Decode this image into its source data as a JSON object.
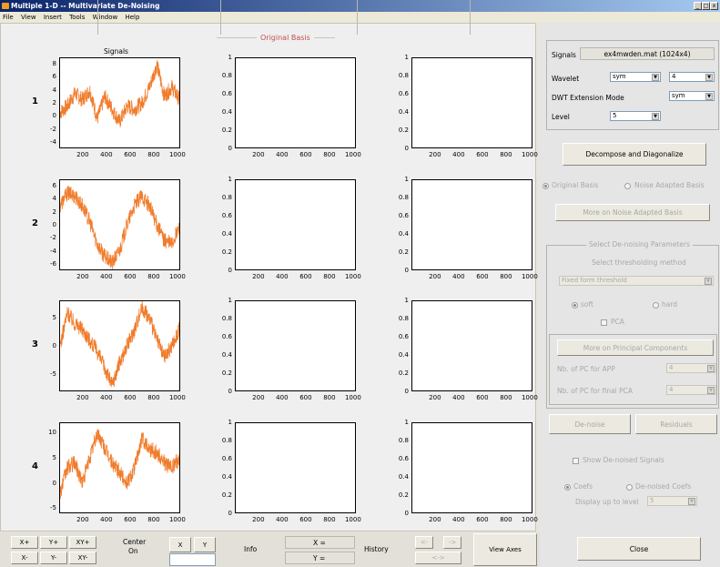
{
  "window": {
    "title": "Multiple 1-D -- Multivariate De-Noising",
    "controls": [
      "_",
      "□",
      "x"
    ]
  },
  "menu": [
    "File",
    "View",
    "Insert",
    "Tools",
    "Window",
    "Help"
  ],
  "plots": {
    "section_title": "Original Basis",
    "column_title": "Signals",
    "row_labels": [
      "1",
      "2",
      "3",
      "4"
    ],
    "x_ticks": [
      "200",
      "400",
      "600",
      "800",
      "1000"
    ],
    "empty_y_ticks": [
      "1",
      "0.8",
      "0.6",
      "0.4",
      "0.2",
      "0"
    ],
    "signal_y_ticks": [
      [
        "8",
        "6",
        "4",
        "2",
        "0",
        "-2",
        "-4"
      ],
      [
        "6",
        "4",
        "2",
        "0",
        "-2",
        "-4",
        "-6"
      ],
      [
        "5",
        "0",
        "-5"
      ],
      [
        "10",
        "5",
        "0",
        "-5"
      ]
    ]
  },
  "chart_data": [
    {
      "type": "line",
      "title": "Signals",
      "ylabel": "1",
      "xlim": [
        1,
        1024
      ],
      "ylim": [
        -5,
        9
      ],
      "series": [
        {
          "color": "#f07c2c",
          "x": [
            1,
            64,
            128,
            192,
            256,
            320,
            384,
            448,
            512,
            576,
            640,
            704,
            768,
            832,
            896,
            960,
            1024
          ],
          "values": [
            0.5,
            1.5,
            3.5,
            2.5,
            4,
            -0.5,
            3,
            1,
            -1,
            1.5,
            1,
            2,
            4.5,
            8,
            3,
            4.5,
            2.5
          ]
        }
      ]
    },
    {
      "type": "line",
      "ylabel": "2",
      "xlim": [
        1,
        1024
      ],
      "ylim": [
        -7,
        7
      ],
      "series": [
        {
          "color": "#f07c2c",
          "x": [
            1,
            64,
            128,
            192,
            256,
            320,
            384,
            448,
            512,
            576,
            640,
            704,
            768,
            832,
            896,
            960,
            1024
          ],
          "values": [
            3,
            5,
            4.5,
            3,
            0.5,
            -3,
            -5,
            -6,
            -4,
            0,
            3,
            4.5,
            3,
            0,
            -2.5,
            -3,
            -0.5
          ]
        }
      ]
    },
    {
      "type": "line",
      "ylabel": "3",
      "xlim": [
        1,
        1024
      ],
      "ylim": [
        -8,
        8
      ],
      "series": [
        {
          "color": "#f07c2c",
          "x": [
            1,
            64,
            128,
            192,
            256,
            320,
            384,
            448,
            512,
            576,
            640,
            704,
            768,
            832,
            896,
            960,
            1024
          ],
          "values": [
            0,
            6,
            4,
            3,
            1,
            -1,
            -4,
            -7,
            -3,
            0,
            3,
            7,
            5,
            1,
            -2,
            0,
            3
          ]
        }
      ]
    },
    {
      "type": "line",
      "ylabel": "4",
      "xlim": [
        1,
        1024
      ],
      "ylim": [
        -6,
        12
      ],
      "series": [
        {
          "color": "#f07c2c",
          "x": [
            1,
            64,
            128,
            192,
            256,
            320,
            384,
            448,
            512,
            576,
            640,
            704,
            768,
            832,
            896,
            960,
            1024
          ],
          "values": [
            -2,
            3,
            4,
            0,
            5,
            10,
            7,
            4,
            2,
            0,
            3,
            9,
            7,
            6,
            4,
            3,
            5
          ]
        }
      ]
    }
  ],
  "right": {
    "signals_label": "Signals",
    "signals_value": "ex4mwden.mat  (1024x4)",
    "wavelet_label": "Wavelet",
    "wavelet_family": "sym",
    "wavelet_order": "4",
    "ext_label": "DWT Extension Mode",
    "ext_value": "sym",
    "level_label": "Level",
    "level_value": "5",
    "decompose": "Decompose and Diagonalize",
    "orig_basis": "Original Basis",
    "noise_basis": "Noise Adapted Basis",
    "more_noise": "More on Noise Adapted Basis",
    "select_params": "Select De-noising Parameters",
    "select_thresh": "Select thresholding method",
    "thresh_value": "Fixed form threshold",
    "soft": "soft",
    "hard": "hard",
    "pca": "PCA",
    "more_pc": "More on Principal Components",
    "nb_app": "Nb. of PC for APP",
    "nb_app_val": "4",
    "nb_final": "Nb. of PC for final PCA",
    "nb_final_val": "4",
    "denoise": "De-noise",
    "residuals": "Residuals",
    "show_denoised": "Show De-noised Signals",
    "coefs": "Coefs",
    "denoised_coefs": "De-noised Coefs",
    "display_level": "Display up to level",
    "display_level_val": "5",
    "close": "Close"
  },
  "bottom": {
    "xp": "X+",
    "yp": "Y+",
    "xyp": "XY+",
    "xm": "X-",
    "ym": "Y-",
    "xym": "XY-",
    "center": "Center",
    "on": "On",
    "x": "X",
    "y": "Y",
    "info": "Info",
    "xeq": "X =",
    "yeq": "Y =",
    "history": "History",
    "hprev": "<-",
    "hnext": "->",
    "hboth": "<->",
    "view_axes": "View Axes"
  }
}
